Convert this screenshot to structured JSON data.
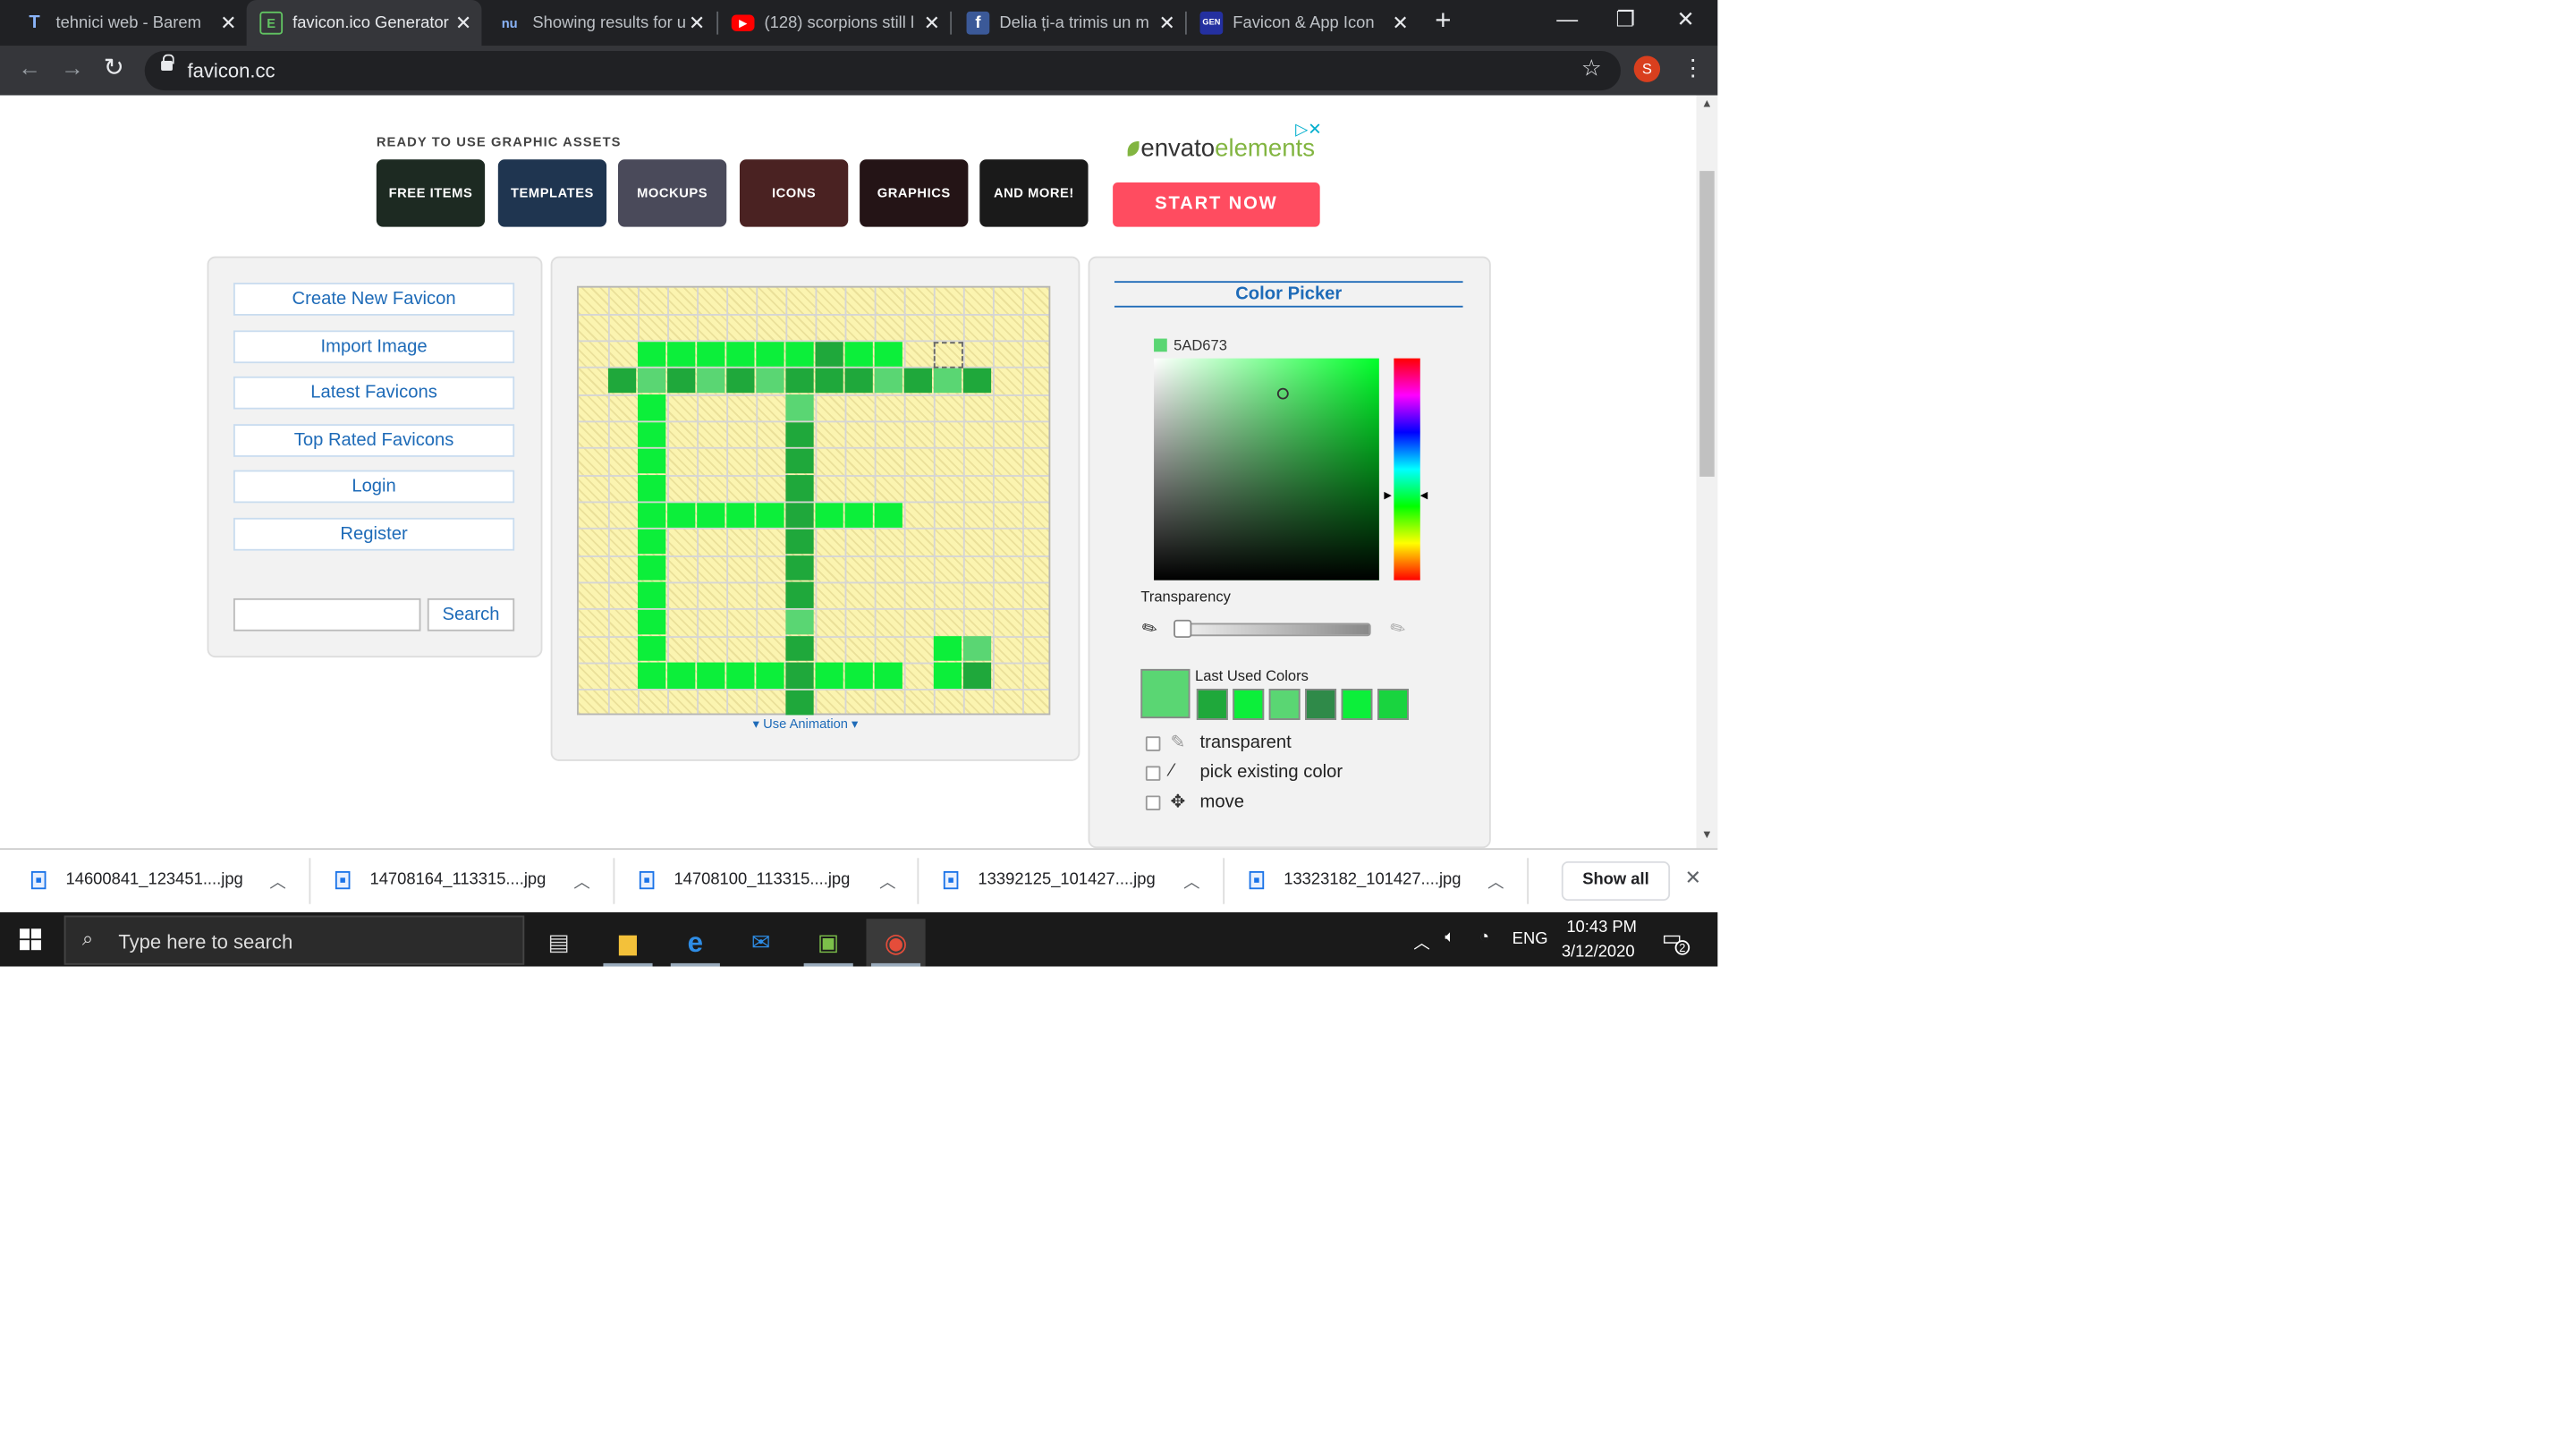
{
  "browser": {
    "tabs": [
      {
        "title": "tehnici web - Barem",
        "icon": "tv-icon"
      },
      {
        "title": "favicon.ico Generator",
        "icon": "favicon-cc-icon"
      },
      {
        "title": "Showing results for u",
        "icon": "nu-icon"
      },
      {
        "title": "(128) scorpions still l",
        "icon": "youtube-icon"
      },
      {
        "title": "Delia ți-a trimis un m",
        "icon": "facebook-icon"
      },
      {
        "title": "Favicon & App Icon",
        "icon": "generator-icon"
      }
    ],
    "new_tab": "+",
    "url": "favicon.cc",
    "profile_initial": "S"
  },
  "ad": {
    "heading": "READY TO USE GRAPHIC ASSETS",
    "tiles": [
      {
        "label": "FREE ITEMS",
        "color": "#1d2a22"
      },
      {
        "label": "TEMPLATES",
        "color": "#1f3550"
      },
      {
        "label": "MOCKUPS",
        "color": "#4a4a5a"
      },
      {
        "label": "ICONS",
        "color": "#4a2222"
      },
      {
        "label": "GRAPHICS",
        "color": "#241416"
      },
      {
        "label": "AND MORE!",
        "color": "#1a1a1a"
      }
    ],
    "brand": "envato",
    "brand_suffix": "elements",
    "cta": "START NOW"
  },
  "sidebar": {
    "links": [
      "Create New Favicon",
      "Import Image",
      "Latest Favicons",
      "Top Rated Favicons",
      "Login",
      "Register"
    ],
    "search_value": "",
    "search_button": "Search"
  },
  "editor": {
    "grid_size": 16,
    "palette": {
      "a": "#0cef3a",
      "b": "#1fa83b",
      "c": "#5ad673",
      "d": "#2f8a49"
    },
    "pixels": [
      {
        "row": 2,
        "cols": [
          2,
          3,
          4,
          5,
          6,
          7,
          8,
          9,
          10
        ],
        "tones": "aaaaaabaa"
      },
      {
        "row": 3,
        "cols": [
          1,
          2,
          3,
          4,
          5,
          6,
          7,
          8,
          9,
          10,
          11,
          12,
          13
        ],
        "tones": "bcbcbcbbbcbcb"
      },
      {
        "row": 4,
        "cols": [
          2,
          7
        ],
        "tones": "ac"
      },
      {
        "row": 5,
        "cols": [
          2,
          7
        ],
        "tones": "ab"
      },
      {
        "row": 6,
        "cols": [
          2,
          7
        ],
        "tones": "ab"
      },
      {
        "row": 7,
        "cols": [
          2,
          7
        ],
        "tones": "ab"
      },
      {
        "row": 8,
        "cols": [
          2,
          3,
          4,
          5,
          6,
          7,
          8,
          9,
          10
        ],
        "tones": "aaaaabaaa"
      },
      {
        "row": 9,
        "cols": [
          2,
          7
        ],
        "tones": "ab"
      },
      {
        "row": 10,
        "cols": [
          2,
          7
        ],
        "tones": "ab"
      },
      {
        "row": 11,
        "cols": [
          2,
          7
        ],
        "tones": "ab"
      },
      {
        "row": 12,
        "cols": [
          2,
          7
        ],
        "tones": "ac"
      },
      {
        "row": 13,
        "cols": [
          2,
          7,
          12,
          13
        ],
        "tones": "abac"
      },
      {
        "row": 14,
        "cols": [
          2,
          3,
          4,
          5,
          6,
          7,
          8,
          9,
          10,
          12,
          13
        ],
        "tones": "aaaaabaaaab"
      },
      {
        "row": 15,
        "cols": [
          7
        ],
        "tones": "b"
      }
    ],
    "selection_cell": {
      "row": 2,
      "col": 12
    },
    "animation_link": "Use Animation"
  },
  "color_picker": {
    "title": "Color Picker",
    "hex": "5AD673",
    "current_color": "#5ad673",
    "transparency_label": "Transparency",
    "transparency_value": 0,
    "last_used_label": "Last Used Colors",
    "last_used": [
      "#1fa83b",
      "#0cef3a",
      "#5ad673",
      "#2f8a49",
      "#0cef3a",
      "#19d43f"
    ],
    "options": [
      {
        "label": "transparent",
        "icon": "eraser-icon"
      },
      {
        "label": "pick existing color",
        "icon": "eyedropper-icon"
      },
      {
        "label": "move",
        "icon": "move-icon"
      }
    ]
  },
  "downloads": {
    "items": [
      "14600841_123451....jpg",
      "14708164_113315....jpg",
      "14708100_113315....jpg",
      "13392125_101427....jpg",
      "13323182_101427....jpg"
    ],
    "show_all": "Show all"
  },
  "taskbar": {
    "search_placeholder": "Type here to search",
    "language": "ENG",
    "time": "10:43 PM",
    "date": "3/12/2020",
    "notification_count": "2"
  }
}
